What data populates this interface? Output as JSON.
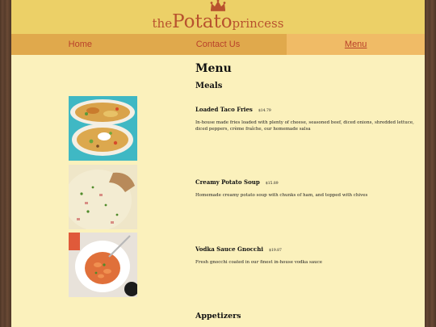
{
  "brand": {
    "prefix": "the",
    "main": "Potato",
    "suffix": "princess"
  },
  "nav": [
    {
      "label": "Home"
    },
    {
      "label": "Contact Us"
    },
    {
      "label": "Menu"
    }
  ],
  "menu": {
    "title": "Menu",
    "meals_heading": "Meals",
    "items": [
      {
        "name": "Loaded Taco Fries",
        "price": "$14.79",
        "description": "In-house made fries loaded with plenty of cheese, seasoned beef, diced onions, shredded lettuce, diced peppers, crème fraîche, our homemade salsa",
        "image": "loaded-taco-fries-photo"
      },
      {
        "name": "Creamy Potato Soup",
        "price": "$15.89",
        "description": "Homemade creamy potato soup with chunks of ham, and topped with chives",
        "image": "creamy-potato-soup-photo"
      },
      {
        "name": "Vodka Sauce Gnocchi",
        "price": "$19.87",
        "description": "Fresh gnocchi coated in our finest in-house vodka sauce",
        "image": "vodka-sauce-gnocchi-photo"
      }
    ],
    "appetizers_heading": "Appetizers"
  },
  "colors": {
    "header_bg": "#ecd067",
    "nav_bg": "#e0a94c",
    "nav_active_bg": "#f0bb66",
    "nav_text": "#b8402a",
    "page_bg": "#fbf1bc",
    "brand": "#b8522e"
  }
}
